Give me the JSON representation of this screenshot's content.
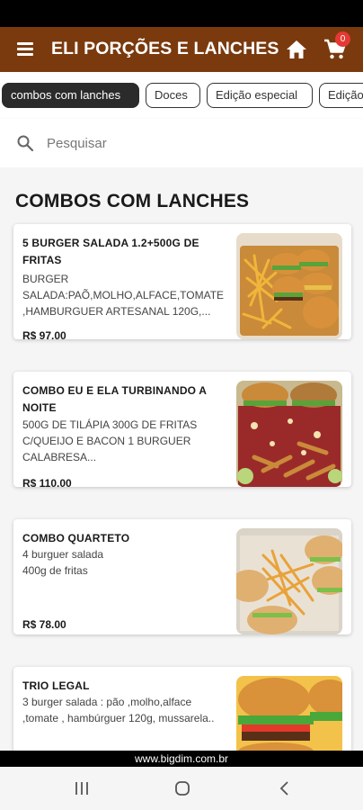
{
  "app": {
    "title": "ELI PORÇÕES E LANCHES",
    "cart_count": "0",
    "colors": {
      "app_bar": "#7a3a0e",
      "badge": "#e53935",
      "chip_active": "#2b2b2b"
    }
  },
  "categories": [
    {
      "label": "combos com lanches",
      "active": true
    },
    {
      "label": "Doces",
      "active": false
    },
    {
      "label": "Edição especial",
      "active": false
    },
    {
      "label": "Edição",
      "active": false
    }
  ],
  "search": {
    "placeholder": "Pesquisar"
  },
  "section": {
    "title": "COMBOS COM LANCHES"
  },
  "products": [
    {
      "name": "5 BURGER SALADA 1.2+500G DE FRITAS",
      "description": "BURGER SALADA:PAÕ,MOLHO,ALFACE,TOMATE ,HAMBURGUER ARTESANAL 120G,...",
      "price": "R$ 97.00"
    },
    {
      "name": "COMBO EU E ELA TURBINANDO A NOITE",
      "description": "500G DE TILÁPIA 300G DE FRITAS C/QUEIJO E BACON 1 BURGUER CALABRESA...",
      "price": "R$ 110.00"
    },
    {
      "name": "COMBO QUARTETO",
      "description": "4 burguer salada 400g de fritas",
      "price": "R$ 78.00"
    },
    {
      "name": "TRIO LEGAL",
      "description": "3 burger salada : pão ,molho,alface ,tomate , hambúrguer 120g, mussarela..",
      "price": ""
    }
  ],
  "footer": {
    "url": "www.bigdim.com.br"
  },
  "icons": {
    "menu": "menu-icon",
    "home": "home-icon",
    "cart": "cart-icon",
    "search": "search-icon",
    "nav_recent": "recent-apps-icon",
    "nav_home": "nav-home-icon",
    "nav_back": "back-icon"
  }
}
